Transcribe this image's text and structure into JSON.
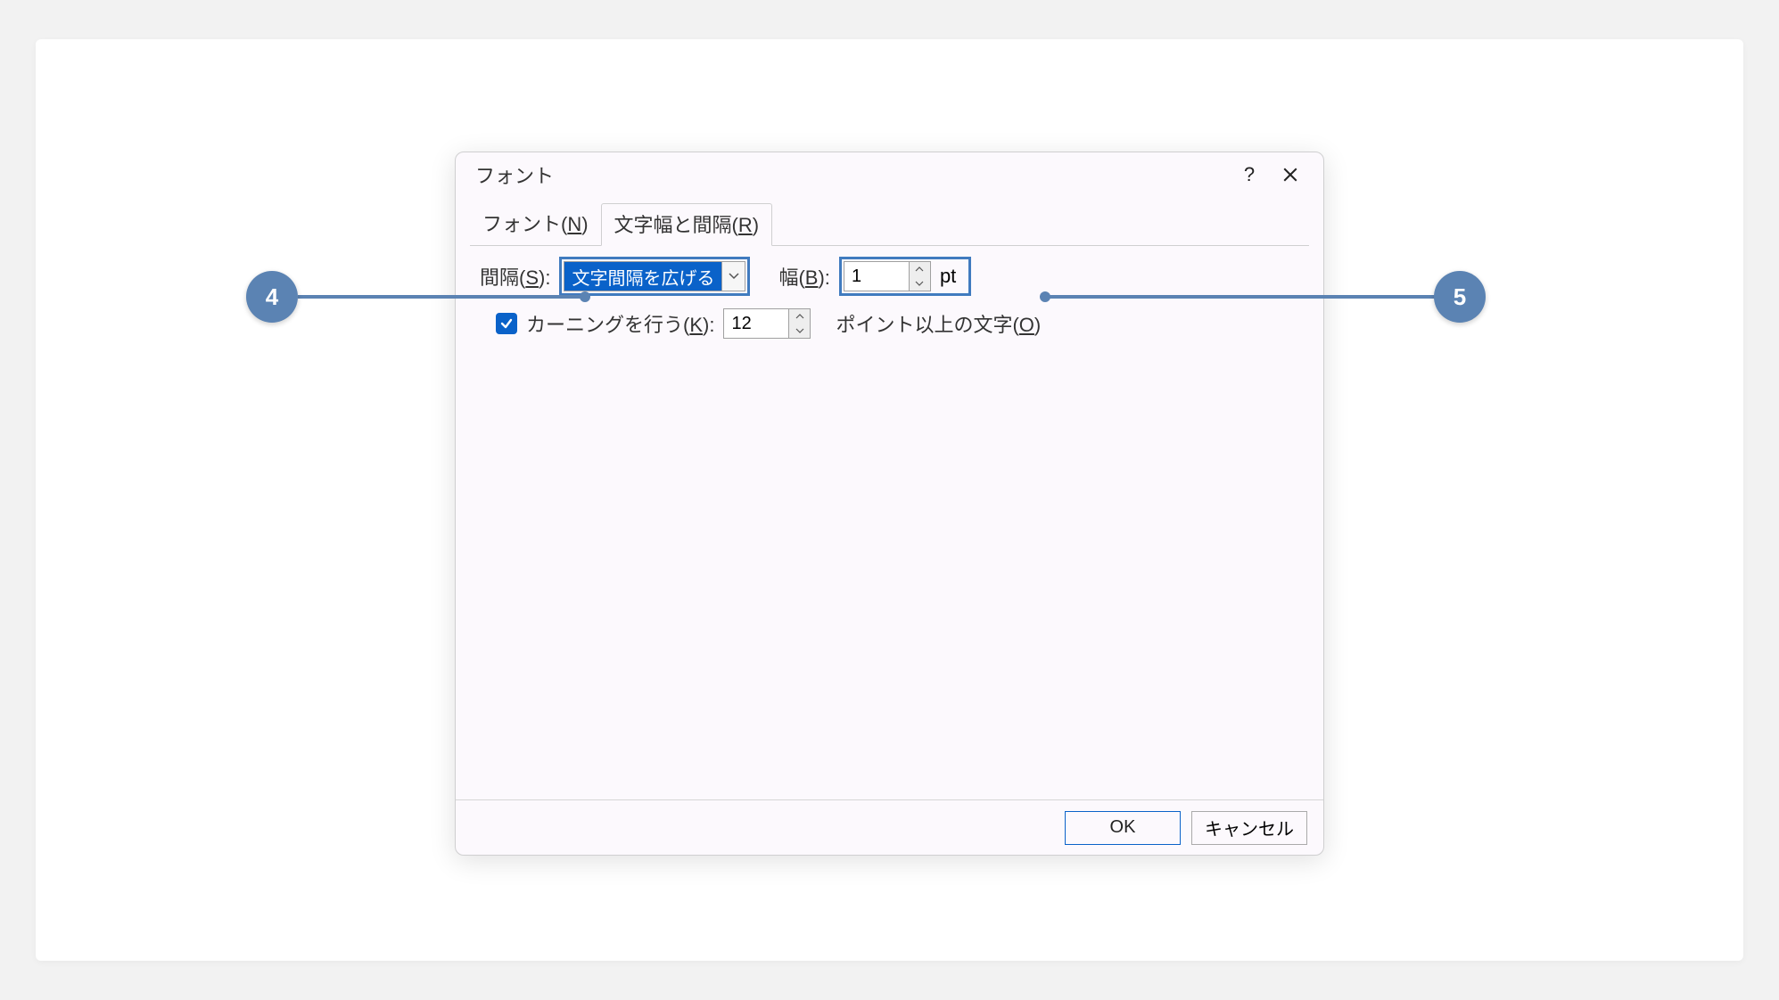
{
  "dialog": {
    "title": "フォント",
    "tabs": {
      "font_prefix": "フォント(",
      "font_accel": "N",
      "font_suffix": ")",
      "spacing_prefix": "文字幅と間隔(",
      "spacing_accel": "R",
      "spacing_suffix": ")"
    },
    "row1": {
      "label_prefix": "間隔(",
      "label_accel": "S",
      "label_suffix": "):",
      "spacing_value": "文字間隔を広げる",
      "width_prefix": "幅(",
      "width_accel": "B",
      "width_suffix": "):",
      "width_value": "1",
      "unit": "pt"
    },
    "row2": {
      "kerning_prefix": "カーニングを行う(",
      "kerning_accel": "K",
      "kerning_suffix": "):",
      "kerning_value": "12",
      "kerning_tail_prefix": "ポイント以上の文字(",
      "kerning_tail_accel": "O",
      "kerning_tail_suffix": ")"
    },
    "buttons": {
      "ok": "OK",
      "cancel": "キャンセル"
    }
  },
  "callouts": {
    "left": "4",
    "right": "5"
  }
}
